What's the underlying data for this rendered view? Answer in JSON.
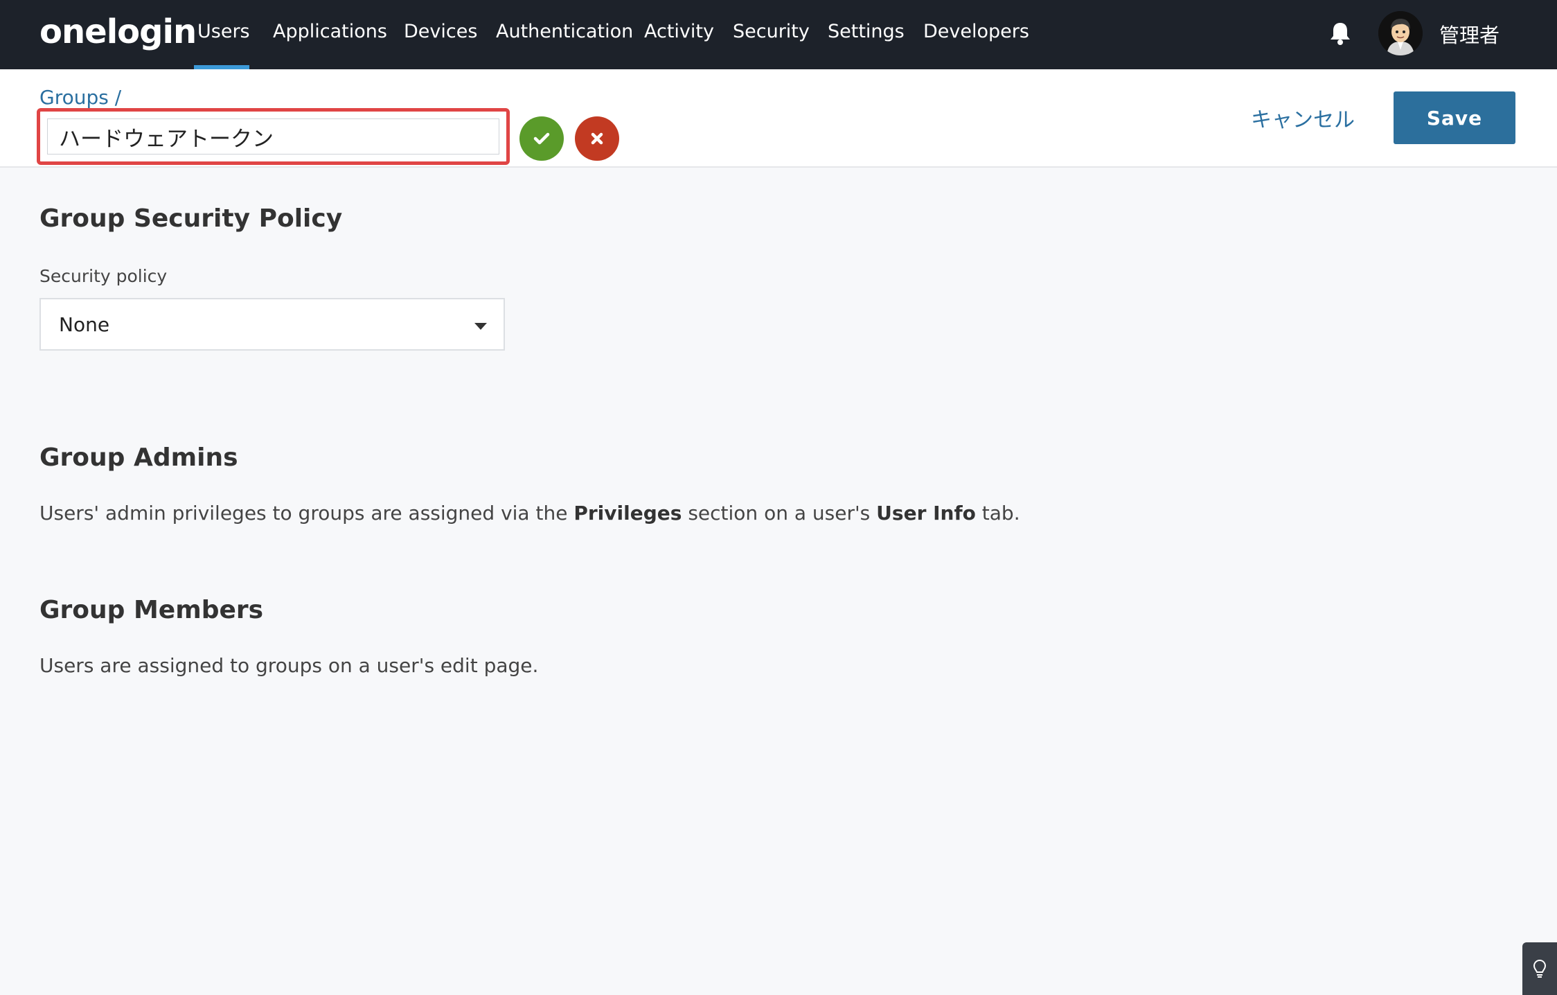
{
  "brand": {
    "logo_text": "onelogin"
  },
  "nav": {
    "items": [
      {
        "label": "Users",
        "active": true
      },
      {
        "label": "Applications"
      },
      {
        "label": "Devices"
      },
      {
        "label": "Authentication"
      },
      {
        "label": "Activity"
      },
      {
        "label": "Security"
      },
      {
        "label": "Settings"
      },
      {
        "label": "Developers"
      }
    ],
    "notifications_icon": "bell-icon",
    "user_name": "管理者"
  },
  "header": {
    "breadcrumb": "Groups /",
    "group_name_value": "ハードウェアトークン",
    "cancel_label": "キャンセル",
    "save_label": "Save"
  },
  "security_policy": {
    "heading": "Group Security Policy",
    "field_label": "Security policy",
    "selected": "None"
  },
  "group_admins": {
    "heading": "Group Admins",
    "text_before": "Users' admin privileges to groups are assigned via the ",
    "bold1": "Privileges",
    "text_middle": " section on a user's ",
    "bold2": "User Info",
    "text_after": " tab."
  },
  "group_members": {
    "heading": "Group Members",
    "text": "Users are assigned to groups on a user's edit page."
  },
  "colors": {
    "nav_bg": "#1d222a",
    "accent_underline": "#3c9ad8",
    "link": "#2a6fa0",
    "save_button": "#2c6f9c",
    "confirm_green": "#5a9b2a",
    "cancel_red": "#c23a22",
    "highlight_border": "#e04545"
  }
}
